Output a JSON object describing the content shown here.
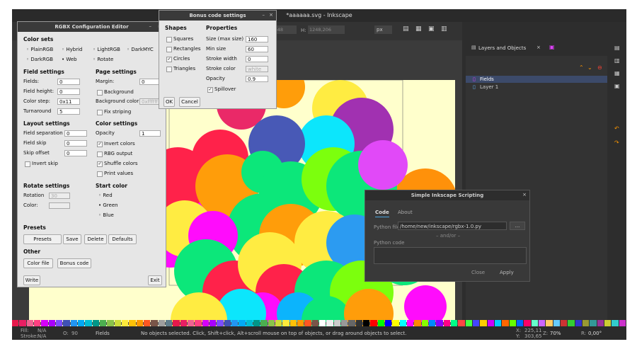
{
  "main": {
    "title": "*aaaaaa.svg - Inkscape",
    "toolbar": {
      "x_label": "X:",
      "x_value": "1333,648",
      "y_label": "H:",
      "y_value": "1248,206",
      "unit": "px"
    },
    "layers_panel": {
      "tab": "Layers and Objects",
      "items": [
        "Fields",
        "Layer 1"
      ]
    },
    "status": {
      "fill_label": "Fill:",
      "fill_value": "N/A",
      "stroke_label": "Stroke:",
      "stroke_value": "N/A",
      "o_label": "O:",
      "o_value": "90",
      "layer": "Fields",
      "message": "No objects selected. Click, Shift+click, Alt+scroll mouse on top of objects, or drag around objects to select.",
      "x_label": "X:",
      "x_value": "225,11",
      "y_label": "Y:",
      "y_value": "303,65",
      "zoom_label": "Z:",
      "zoom_value": "70%",
      "rot_label": "R:",
      "rot_value": "0,00°"
    },
    "palette_colors": [
      "#e6194b",
      "#e91e63",
      "#f06292",
      "#ff4081",
      "#d500f9",
      "#aa00ff",
      "#7c4dff",
      "#3f51b5",
      "#2196f3",
      "#03a9f4",
      "#00bcd4",
      "#009688",
      "#4caf50",
      "#8bc34a",
      "#cddc39",
      "#ffeb3b",
      "#ffc107",
      "#ff9800",
      "#ff5722",
      "#795548",
      "#9e9e9e",
      "#607d8b",
      "#e6194b",
      "#e91e63",
      "#f06292",
      "#ff4081",
      "#d500f9",
      "#aa00ff",
      "#7c4dff",
      "#3f51b5",
      "#2196f3",
      "#03a9f4",
      "#00bcd4",
      "#009688",
      "#4caf50",
      "#8bc34a",
      "#cddc39",
      "#ffeb3b",
      "#ffc107",
      "#ff9800",
      "#ff5722",
      "#795548",
      "#ffffff",
      "#eeeeee",
      "#cccccc",
      "#999999",
      "#666666",
      "#333333",
      "#000000",
      "#ff0000",
      "#00ff00",
      "#0000ff",
      "#ffff00",
      "#00ffff",
      "#ff00ff",
      "#ff8800",
      "#88ff00",
      "#0088ff",
      "#8800ff",
      "#ff0088",
      "#00ff88",
      "#ff4444",
      "#44ff44",
      "#4444ff",
      "#ffcc00",
      "#cc00ff",
      "#00ccff",
      "#ff6600",
      "#66ff00",
      "#0066ff",
      "#ff0066",
      "#66ffcc",
      "#cc66ff",
      "#ffcc66",
      "#66ccff",
      "#cc3333",
      "#33cc33",
      "#3333cc",
      "#999933",
      "#339999",
      "#993399",
      "#cccc33",
      "#33cccc",
      "#cc33cc"
    ]
  },
  "rgbx": {
    "title": "RGBX Configuration Editor",
    "color_sets": {
      "heading": "Color sets",
      "options": [
        "PlainRGB",
        "Hybrid",
        "LightRGB",
        "DarkMYC",
        "DarkRGB",
        "Web",
        "Rotate"
      ],
      "selected": "Web"
    },
    "field_settings": {
      "heading": "Field settings",
      "fields_label": "Fields:",
      "fields": "0",
      "field_height_label": "Field height:",
      "field_height": "0",
      "color_step_label": "Color step:",
      "color_step": "0x11",
      "turnaround_label": "Turnaround",
      "turnaround": "5"
    },
    "page_settings": {
      "heading": "Page settings",
      "margin_label": "Margin:",
      "margin": "0",
      "background_label": "Background",
      "background_color_label": "Background color",
      "background_color": "0xffffff",
      "fix_striping_label": "Fix striping"
    },
    "layout_settings": {
      "heading": "Layout settings",
      "field_separation_label": "Field separation",
      "field_separation": "0",
      "field_skip_label": "Field skip",
      "field_skip": "0",
      "skip_offset_label": "Skip offset",
      "skip_offset": "0",
      "invert_skip_label": "Invert skip"
    },
    "color_settings": {
      "heading": "Color settings",
      "opacity_label": "Opacity",
      "opacity": "1",
      "invert_colors_label": "Invert colors",
      "rbg_output_label": "RBG output",
      "shuffle_colors_label": "Shuffle colors",
      "print_values_label": "Print values"
    },
    "rotate_settings": {
      "heading": "Rotate settings",
      "rotation_label": "Rotation",
      "rotation": "30",
      "color_label": "Color:"
    },
    "start_color": {
      "heading": "Start color",
      "options": [
        "Red",
        "Green",
        "Blue"
      ],
      "selected": "Green"
    },
    "presets": {
      "heading": "Presets",
      "presets_btn": "Presets",
      "save_btn": "Save",
      "delete_btn": "Delete",
      "defaults_btn": "Defaults"
    },
    "other": {
      "heading": "Other",
      "color_file_btn": "Color file",
      "bonus_code_btn": "Bonus code"
    },
    "write_btn": "Write",
    "exit_btn": "Exit"
  },
  "bonus": {
    "title": "Bonus code settings",
    "shapes": {
      "heading": "Shapes",
      "options": [
        "Squares",
        "Rectangles",
        "Circles",
        "Triangles"
      ],
      "checked": "Circles"
    },
    "properties": {
      "heading": "Properties",
      "size_max_label": "Size (max size)",
      "size_max": "160",
      "min_size_label": "Min size",
      "min_size": "60",
      "stroke_width_label": "Stroke width",
      "stroke_width": "0",
      "stroke_color_label": "Stroke color",
      "stroke_color": "white",
      "opacity_label": "Opacity",
      "opacity": "0.9",
      "spillover_label": "Spillover"
    },
    "ok_btn": "OK",
    "cancel_btn": "Cancel"
  },
  "scripting": {
    "title": "Simple Inkscape Scripting",
    "tabs": [
      "Code",
      "About"
    ],
    "python_file_label": "Python file",
    "python_file": "/home/new/inkscape/rgbx-1.0.py",
    "browse_btn": "...",
    "andor": "– and/or –",
    "python_code_label": "Python code",
    "close_btn": "Close",
    "apply_btn": "Apply"
  }
}
